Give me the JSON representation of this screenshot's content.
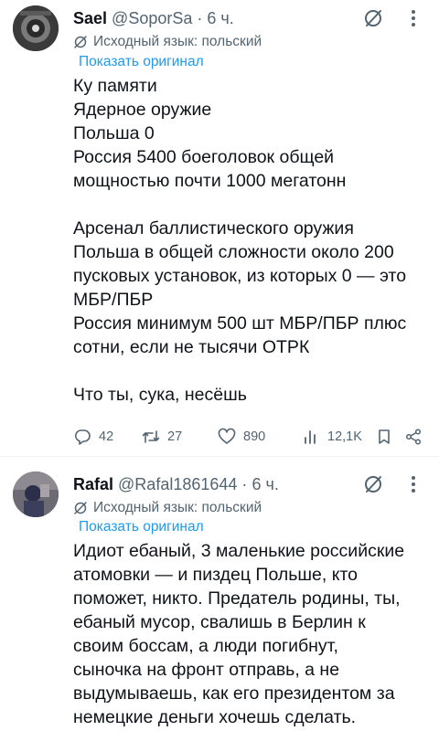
{
  "tweets": [
    {
      "author": "Sael",
      "handle": "@SoporSa",
      "separator": "·",
      "time": "6 ч.",
      "translated_label": "Исходный язык: польский",
      "show_original": "Показать оригинал",
      "lines": [
        "Ку памяти",
        "Ядерное оружие",
        "Польша 0",
        "Россия 5400 боеголовок общей",
        "мощностью почти 1000 мегатонн",
        "",
        "Арсенал баллистического оружия",
        "Польша в общей сложности около 200",
        "пусковых установок, из которых 0 — это",
        "МБР/ПБР",
        "Россия минимум 500 шт МБР/ПБР плюс",
        "сотни, если не тысячи ОТРК",
        "",
        "Что ты, сука, несёшь"
      ],
      "stats": {
        "replies": "42",
        "retweets": "27",
        "likes": "890",
        "views": "12,1K"
      }
    },
    {
      "author": "Rafal",
      "handle": "@Rafal1861644",
      "separator": "·",
      "time": "6 ч.",
      "translated_label": "Исходный язык: польский",
      "show_original": "Показать оригинал",
      "lines": [
        "Идиот ебаный, 3 маленькие российские",
        "атомовки — и пиздец Польше, кто",
        "поможет, никто. Предатель родины, ты,",
        "ебаный мусор, свалишь в Берлин к",
        "своим боссам, а люди погибнут,",
        "сыночка на фронт отправь, а не",
        "выдумываешь, как его президентом за",
        "немецкие деньги хочешь сделать."
      ]
    }
  ],
  "icons": {
    "reply": "reply-icon",
    "retweet": "retweet-icon",
    "like": "heart-icon",
    "views": "views-icon",
    "bookmark": "bookmark-icon",
    "share": "share-icon",
    "grok": "grok-icon",
    "more": "more-icon",
    "translate": "translate-icon"
  },
  "colors": {
    "text": "#0f1419",
    "secondary": "#536471",
    "link": "#1d9bf0",
    "divider": "#eff3f4"
  }
}
